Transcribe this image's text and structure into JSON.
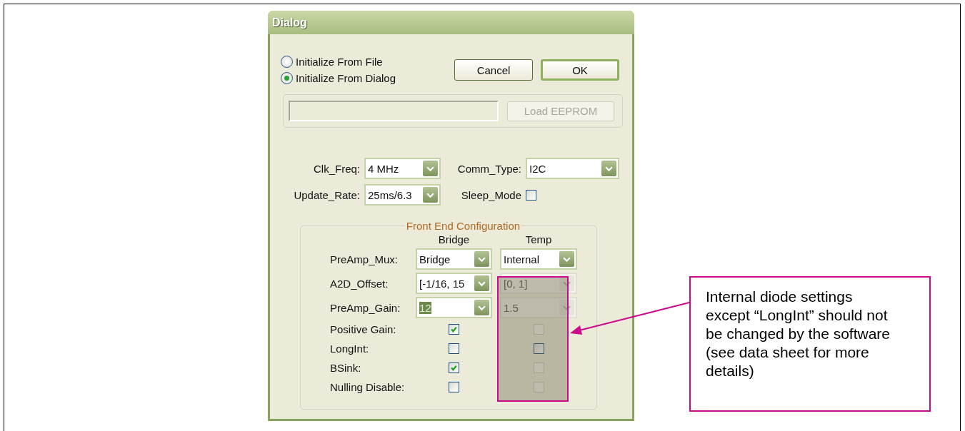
{
  "window": {
    "title": "Dialog"
  },
  "init_options": [
    {
      "label": "Initialize From File",
      "selected": false
    },
    {
      "label": "Initialize From Dialog",
      "selected": true
    }
  ],
  "buttons": [
    {
      "label": "Cancel",
      "kind": "normal"
    },
    {
      "label": "OK",
      "kind": "default"
    }
  ],
  "eeprom": {
    "load_button": {
      "label": "Load EEPROM",
      "disabled": true
    }
  },
  "settings": [
    {
      "label": "Clk_Freq:",
      "kind": "dropdown",
      "value": "4 MHz"
    },
    {
      "label": "Comm_Type:",
      "kind": "dropdown",
      "value": "I2C"
    },
    {
      "label": "Update_Rate:",
      "kind": "dropdown",
      "value": "25ms/6.3"
    },
    {
      "label": "Sleep_Mode",
      "kind": "checkbox",
      "checked": false
    }
  ],
  "front_end": {
    "title": "Front End Configuration",
    "columns": [
      "Bridge",
      "Temp"
    ],
    "dropdown_rows": [
      {
        "label": "PreAmp_Mux:",
        "bridge": {
          "value": "Bridge",
          "disabled": false,
          "highlighted": false
        },
        "temp": {
          "value": "Internal",
          "disabled": false,
          "highlighted": false
        }
      },
      {
        "label": "A2D_Offset:",
        "bridge": {
          "value": "[-1/16, 15",
          "disabled": false,
          "highlighted": false
        },
        "temp": {
          "value": "[0, 1]",
          "disabled": true,
          "highlighted": false
        }
      },
      {
        "label": "PreAmp_Gain:",
        "bridge": {
          "value": "12",
          "disabled": false,
          "highlighted": true
        },
        "temp": {
          "value": "1.5",
          "disabled": true,
          "highlighted": false
        }
      }
    ],
    "checkbox_rows": [
      {
        "label": "Positive Gain:",
        "bridge": {
          "checked": true,
          "disabled": false
        },
        "temp": {
          "checked": false,
          "disabled": true
        }
      },
      {
        "label": "LongInt:",
        "bridge": {
          "checked": false,
          "disabled": false
        },
        "temp": {
          "checked": false,
          "disabled": false
        }
      },
      {
        "label": "BSink:",
        "bridge": {
          "checked": true,
          "disabled": false
        },
        "temp": {
          "checked": false,
          "disabled": true
        }
      },
      {
        "label": "Nulling Disable:",
        "bridge": {
          "checked": false,
          "disabled": false
        },
        "temp": {
          "checked": false,
          "disabled": true
        }
      }
    ]
  },
  "annotation": {
    "text": "Internal diode settings except “LongInt” should not be changed by the software (see data sheet for more details)"
  }
}
